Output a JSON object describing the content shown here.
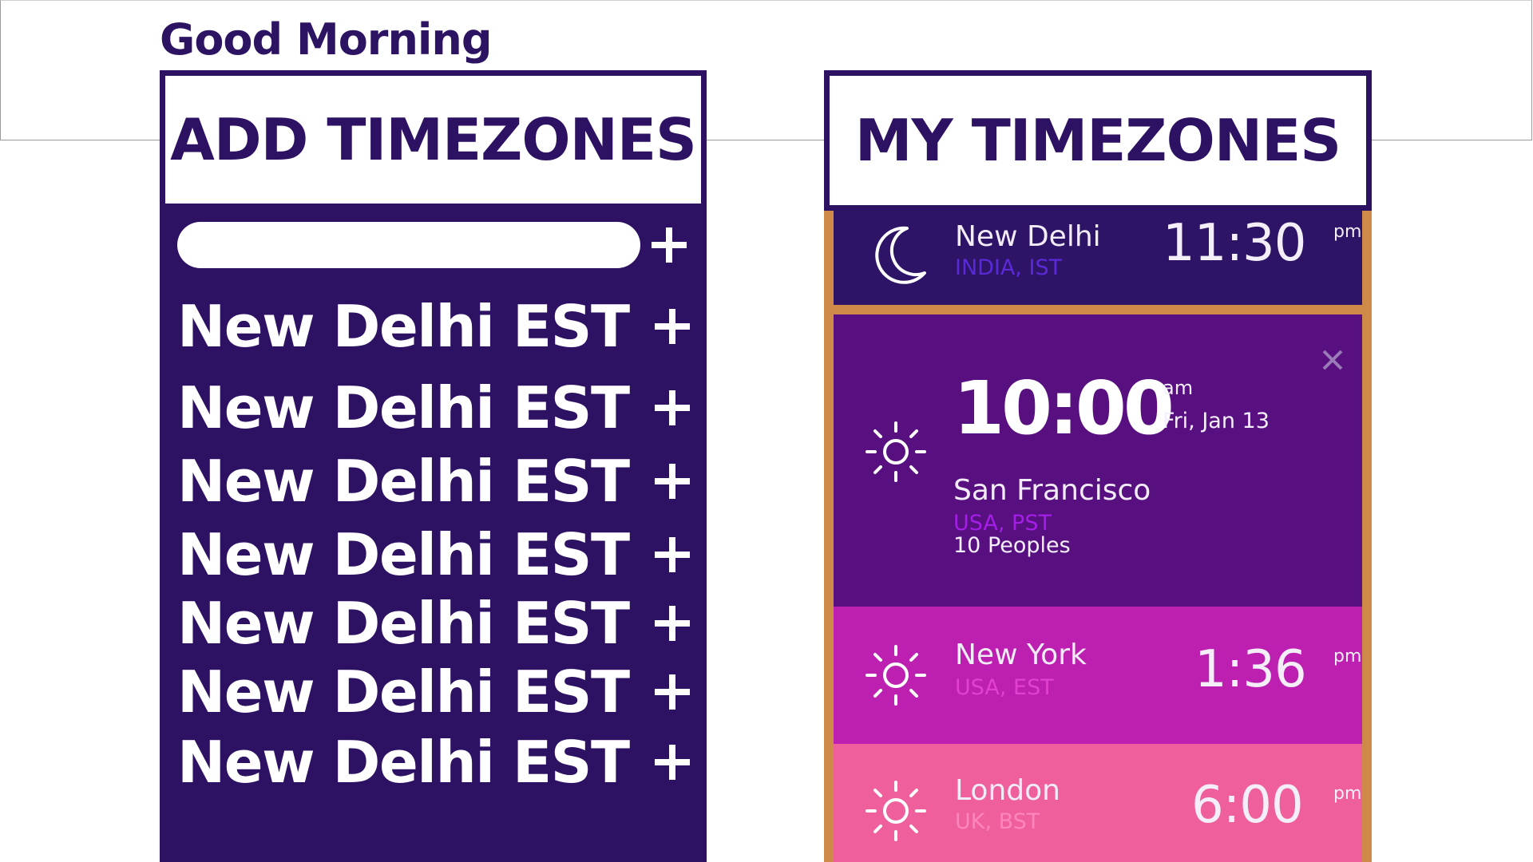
{
  "greeting": "Good Morning",
  "add_panel": {
    "title": "ADD TIMEZONES",
    "search": {
      "value": "",
      "placeholder": ""
    },
    "items": [
      {
        "label": "New Delhi EST"
      },
      {
        "label": "New Delhi EST"
      },
      {
        "label": "New Delhi EST"
      },
      {
        "label": "New Delhi EST"
      },
      {
        "label": "New Delhi EST"
      },
      {
        "label": "New Delhi EST"
      },
      {
        "label": "New Delhi EST"
      }
    ],
    "add_icon": "plus-icon"
  },
  "my_panel": {
    "title": "MY TIMEZONES",
    "cards": [
      {
        "city": "New Delhi",
        "region": "INDIA, IST",
        "time": "11:30",
        "meridiem": "pm",
        "icon": "moon-icon",
        "background": "#2d1466",
        "region_color": "#5b2ad8"
      },
      {
        "city": "San Francisco",
        "region": "USA, PST",
        "time": "10:00",
        "meridiem": "am",
        "date": "Fri, Jan 13",
        "people": "10 Peoples",
        "icon": "sun-icon",
        "background": "#580f80",
        "region_color": "#a51ee8"
      },
      {
        "city": "New York",
        "region": "USA, EST",
        "time": "1:36",
        "meridiem": "pm",
        "icon": "sun-icon",
        "background": "#bd1fb0",
        "region_color": "#e240cf"
      },
      {
        "city": "London",
        "region": "UK, BST",
        "time": "6:00",
        "meridiem": "pm",
        "icon": "sun-icon",
        "background": "#ef5f9b",
        "region_color": "#ff86bd"
      }
    ]
  },
  "colors": {
    "brand": "#2d1163",
    "panel_accent": "#cf8a4a",
    "text_on_dark": "#ffffff"
  }
}
